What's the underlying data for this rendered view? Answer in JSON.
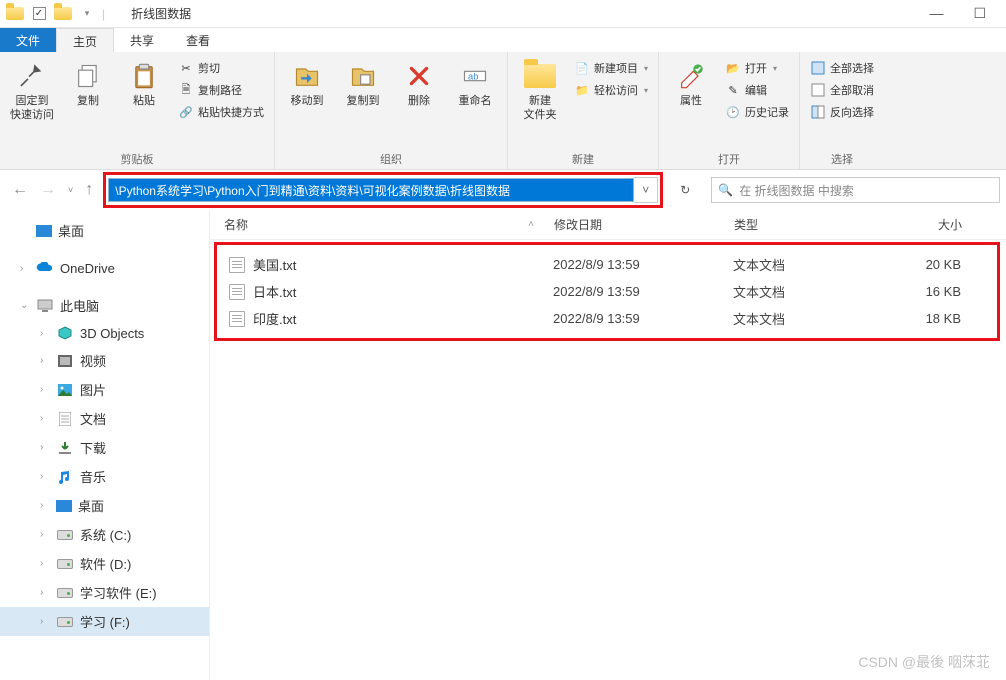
{
  "window": {
    "title": "折线图数据"
  },
  "qat": {
    "checkbox_checked": true
  },
  "tabs": {
    "file": "文件",
    "home": "主页",
    "share": "共享",
    "view": "查看",
    "active": "home"
  },
  "ribbon": {
    "clipboard": {
      "label": "剪贴板",
      "pin": "固定到\n快速访问",
      "copy": "复制",
      "paste": "粘贴",
      "cut": "剪切",
      "copy_path": "复制路径",
      "paste_shortcut": "粘贴快捷方式"
    },
    "organize": {
      "label": "组织",
      "move_to": "移动到",
      "copy_to": "复制到",
      "delete": "删除",
      "rename": "重命名"
    },
    "new": {
      "label": "新建",
      "new_folder": "新建\n文件夹",
      "new_item": "新建项目",
      "easy_access": "轻松访问"
    },
    "open": {
      "label": "打开",
      "properties": "属性",
      "open": "打开",
      "edit": "编辑",
      "history": "历史记录"
    },
    "select": {
      "label": "选择",
      "select_all": "全部选择",
      "select_none": "全部取消",
      "invert": "反向选择"
    }
  },
  "nav": {
    "address": "\\Python系统学习\\Python入门到精通\\资料\\资料\\可视化案例数据\\折线图数据",
    "search_placeholder": "在 折线图数据 中搜索"
  },
  "columns": {
    "name": "名称",
    "date": "修改日期",
    "type": "类型",
    "size": "大小"
  },
  "sidebar": {
    "desktop1": "桌面",
    "onedrive": "OneDrive",
    "this_pc": "此电脑",
    "objects3d": "3D Objects",
    "videos": "视频",
    "pictures": "图片",
    "documents": "文档",
    "downloads": "下载",
    "music": "音乐",
    "desktop2": "桌面",
    "drive_c": "系统 (C:)",
    "drive_d": "软件 (D:)",
    "drive_e": "学习软件 (E:)",
    "drive_f": "学习 (F:)"
  },
  "files": [
    {
      "name": "美国.txt",
      "date": "2022/8/9 13:59",
      "type": "文本文档",
      "size": "20 KB"
    },
    {
      "name": "日本.txt",
      "date": "2022/8/9 13:59",
      "type": "文本文档",
      "size": "16 KB"
    },
    {
      "name": "印度.txt",
      "date": "2022/8/9 13:59",
      "type": "文本文档",
      "size": "18 KB"
    }
  ],
  "watermark": "CSDN @最後 咽莯苝"
}
